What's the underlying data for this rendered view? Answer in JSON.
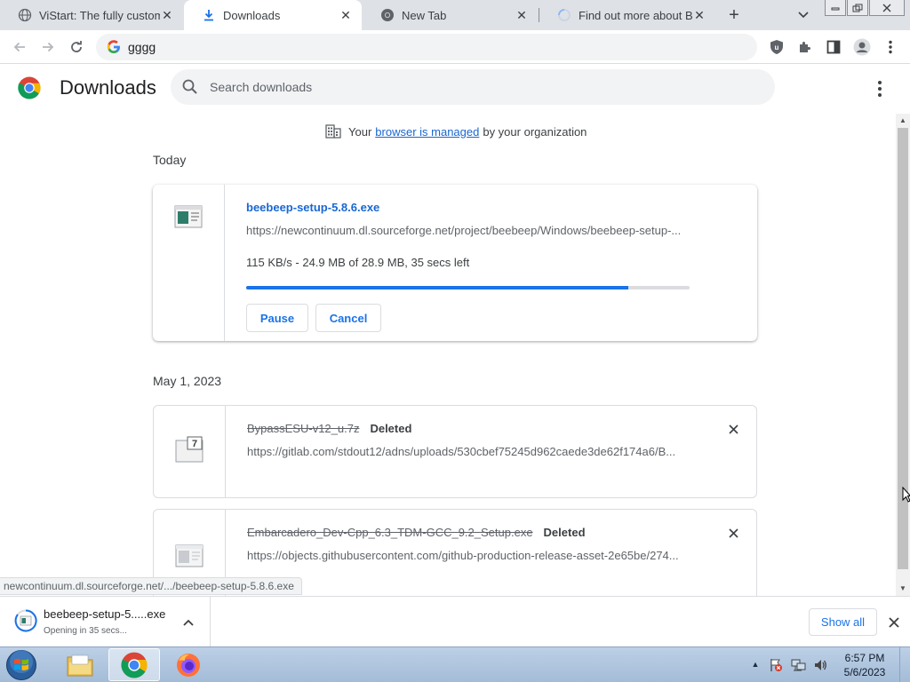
{
  "tabs": [
    {
      "title": "ViStart: The fully customizable",
      "icon": "globe-icon"
    },
    {
      "title": "Downloads",
      "icon": "download-icon"
    },
    {
      "title": "New Tab",
      "icon": "chrome-icon"
    },
    {
      "title": "Find out more about BeeBEEP",
      "icon": "loading-icon"
    }
  ],
  "toolbar": {
    "omnibox_text": "gggg"
  },
  "page": {
    "title": "Downloads",
    "search_placeholder": "Search downloads",
    "managed_prefix": "Your",
    "managed_link": "browser is managed",
    "managed_suffix": "by your organization"
  },
  "groups": [
    {
      "date": "Today"
    },
    {
      "date": "May 1, 2023"
    }
  ],
  "active_download": {
    "name": "beebeep-setup-5.8.6.exe",
    "url": "https://newcontinuum.dl.sourceforge.net/project/beebeep/Windows/beebeep-setup-...",
    "status": "115 KB/s - 24.9 MB of 28.9 MB, 35 secs left",
    "progress": 0.862,
    "pause_label": "Pause",
    "cancel_label": "Cancel"
  },
  "deleted_downloads": [
    {
      "name": "BypassESU-v12_u.7z",
      "tag": "Deleted",
      "url": "https://gitlab.com/stdout12/adns/uploads/530cbef75245d962caede3de62f174a6/B..."
    },
    {
      "name": "Embarcadero_Dev-Cpp_6.3_TDM-GCC_9.2_Setup.exe",
      "tag": "Deleted",
      "url": "https://objects.githubusercontent.com/github-production-release-asset-2e65be/274..."
    }
  ],
  "status_bubble": "newcontinuum.dl.sourceforge.net/.../beebeep-setup-5.8.6.exe",
  "shelf": {
    "item_name": "beebeep-setup-5.....exe",
    "item_sub": "Opening in 35 secs...",
    "show_all": "Show all"
  },
  "taskbar": {
    "time": "6:57 PM",
    "date": "5/6/2023"
  },
  "colors": {
    "accent": "#1a73e8",
    "link": "#1967d2",
    "tabstrip": "#dee1e6"
  }
}
